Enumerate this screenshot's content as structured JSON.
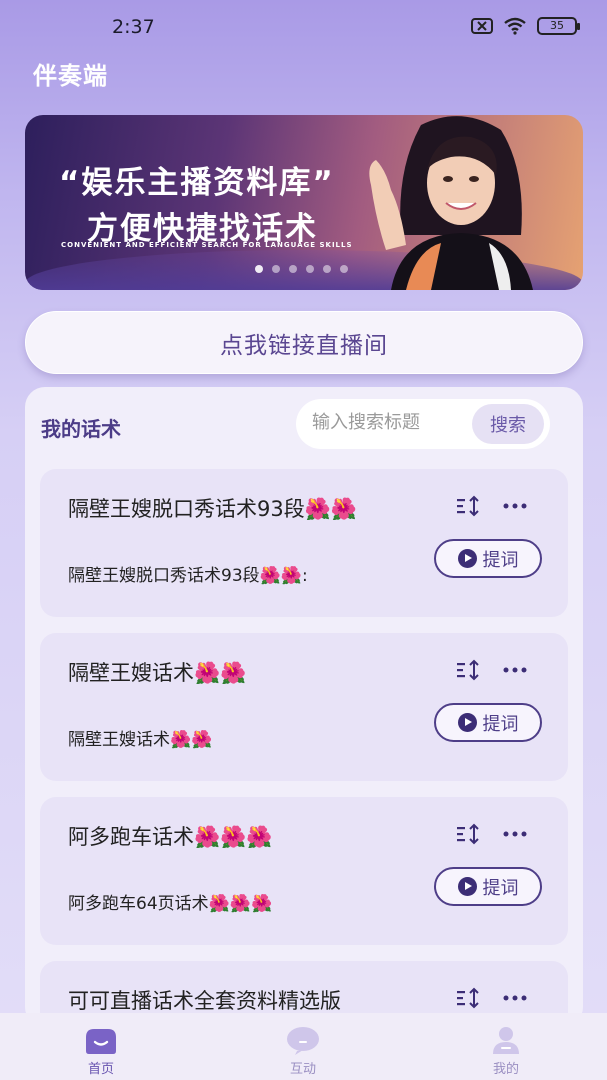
{
  "status_bar": {
    "time": "2:37",
    "battery": "35"
  },
  "header": {
    "title": "伴奏端"
  },
  "banner": {
    "line1": "“娱乐主播资料库”",
    "line2": "方便快捷找话术",
    "subtitle": "CONVENIENT AND EFFICIENT SEARCH FOR LANGUAGE SKILLS",
    "dot_count": 6,
    "active_dot": 0
  },
  "connect_button": {
    "label": "点我链接直播间"
  },
  "scripts_panel": {
    "title": "我的话术",
    "search": {
      "placeholder": "输入搜索标题",
      "button_label": "搜索"
    },
    "action_label": "提词",
    "flower_emoji": "🌺",
    "cards": [
      {
        "title": "隔壁王嫂脱口秀话术93段🌺🌺",
        "desc": "隔壁王嫂脱口秀话术93段🌺🌺:"
      },
      {
        "title": "隔壁王嫂话术🌺🌺",
        "desc": "隔壁王嫂话术🌺🌺"
      },
      {
        "title": "阿多跑车话术🌺🌺🌺",
        "desc": "阿多跑车64页话术🌺🌺🌺"
      },
      {
        "title": "可可直播话术全套资料精选版",
        "desc": ""
      }
    ]
  },
  "tabbar": {
    "items": [
      {
        "label": "首页",
        "icon": "home-icon",
        "active": true
      },
      {
        "label": "互动",
        "icon": "chat-icon",
        "active": false
      },
      {
        "label": "我的",
        "icon": "profile-icon",
        "active": false
      }
    ]
  },
  "colors": {
    "accent": "#4e3e88",
    "tab_active": "#6854b0",
    "tab_inactive": "#c8bfe6"
  }
}
